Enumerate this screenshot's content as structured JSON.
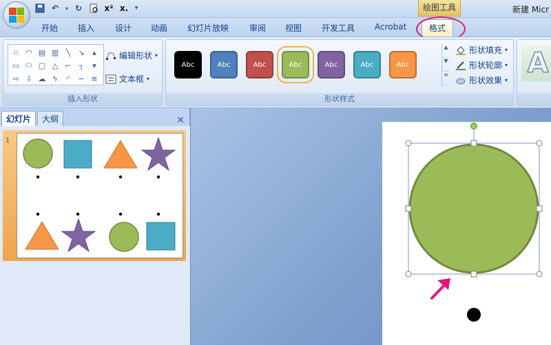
{
  "titlebar": {
    "context_tab": "绘图工具",
    "window_title": "新建 Micr",
    "quick_access": [
      "save-icon",
      "undo-icon",
      "redo-icon",
      "print-preview-icon",
      "superscript-icon",
      "subscript-icon",
      "customize-qat-icon"
    ]
  },
  "tabs": [
    "开始",
    "插入",
    "设计",
    "动画",
    "幻灯片放映",
    "审阅",
    "视图",
    "开发工具",
    "Acrobat",
    "格式"
  ],
  "active_tab": "格式",
  "ribbon": {
    "insert_shapes": {
      "label": "插入形状",
      "edit_shape": "编辑形状",
      "text_box": "文本框"
    },
    "shape_styles": {
      "label": "形状样式",
      "swatch_text": "Abc",
      "swatches": [
        {
          "color": "#000000"
        },
        {
          "color": "#4f81bd"
        },
        {
          "color": "#c0504d"
        },
        {
          "color": "#9bbb59"
        },
        {
          "color": "#8064a2"
        },
        {
          "color": "#4bacc6"
        },
        {
          "color": "#f79646"
        }
      ],
      "selected_index": 3,
      "fill": "形状填充",
      "outline": "形状轮廓",
      "effects": "形状效果"
    },
    "wordart_preview": "A"
  },
  "left_pane": {
    "tab_slides": "幻灯片",
    "tab_outline": "大纲",
    "slide_number": "1"
  },
  "colors": {
    "accent_circle": "#e0187c",
    "shape_green": "#9bbb59",
    "shape_green_border": "#71893f",
    "shape_blue": "#4bacc6",
    "shape_orange": "#f79646",
    "shape_purple": "#8064a2"
  }
}
